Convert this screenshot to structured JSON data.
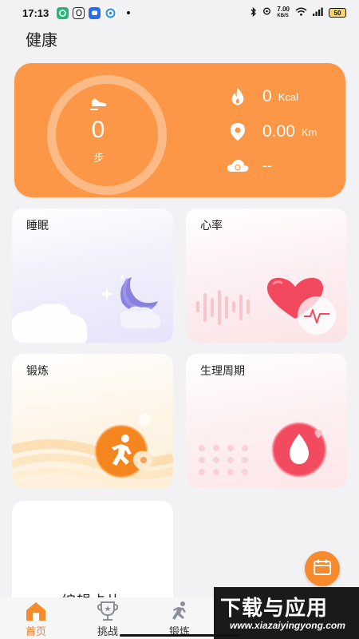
{
  "status_bar": {
    "time": "17:13",
    "network_speed_value": "7.00",
    "network_speed_unit": "KB/S",
    "battery": "50",
    "app_icons": [
      "chat-app-icon",
      "qq-icon",
      "messenger-icon",
      "browser-icon"
    ]
  },
  "page": {
    "title": "健康"
  },
  "summary": {
    "steps_value": "0",
    "steps_unit": "步",
    "calories_value": "0",
    "calories_unit": "Kcal",
    "distance_value": "0.00",
    "distance_unit": "Km",
    "weather_value": "--",
    "color": "#fb9746"
  },
  "tiles": {
    "sleep": "睡眠",
    "heart_rate": "心率",
    "training": "锻炼",
    "cycle": "生理周期",
    "edit": "编辑卡片"
  },
  "nav": {
    "items": [
      {
        "label": "首页",
        "icon": "home-icon",
        "active": true
      },
      {
        "label": "挑战",
        "icon": "trophy-icon",
        "active": false
      },
      {
        "label": "锻炼",
        "icon": "runner-icon",
        "active": false
      }
    ],
    "accent": "#f4822a"
  },
  "watermark": {
    "main": "下载与应用",
    "sub": "www.xiazaiyingyong.com"
  }
}
